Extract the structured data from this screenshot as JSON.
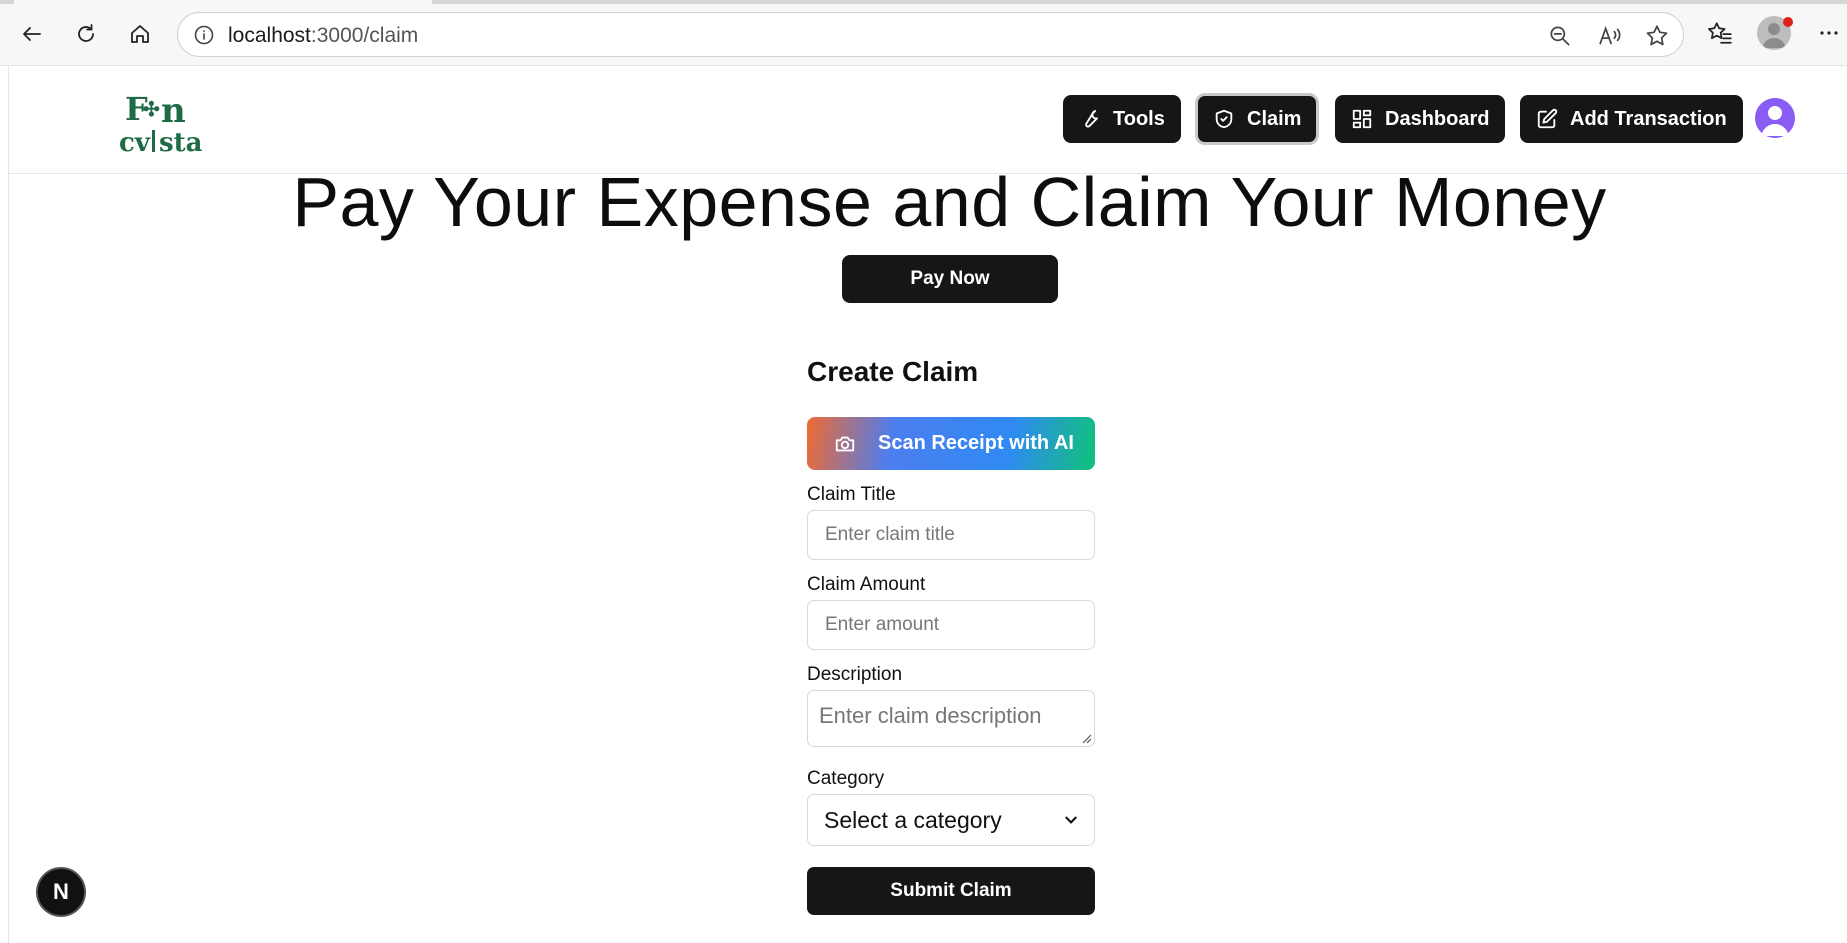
{
  "browser": {
    "url_host": "localhost",
    "url_path": ":3000/claim",
    "icons": [
      "back-arrow-icon",
      "refresh-icon",
      "home-icon",
      "info-icon",
      "zoom-out-icon",
      "read-aloud-icon",
      "favorite-star-icon",
      "favorites-icon",
      "profile-icon",
      "more-icon"
    ]
  },
  "header": {
    "logo_alt": "Fin cvista",
    "nav": [
      {
        "label": "Tools",
        "icon": "wrench-icon"
      },
      {
        "label": "Claim",
        "icon": "shield-icon",
        "active": true
      },
      {
        "label": "Dashboard",
        "icon": "dashboard-icon"
      },
      {
        "label": "Add Transaction",
        "icon": "edit-icon"
      }
    ]
  },
  "hero": {
    "title": "Pay Your Expense and Claim Your Money",
    "pay_button": "Pay Now"
  },
  "form": {
    "title": "Create Claim",
    "scan_button": "Scan Receipt with AI",
    "title_label": "Claim Title",
    "title_placeholder": "Enter claim title",
    "amount_label": "Claim Amount",
    "amount_placeholder": "Enter amount",
    "description_label": "Description",
    "description_placeholder": "Enter claim description",
    "category_label": "Category",
    "category_selected": "Select a category",
    "submit_button": "Submit Claim"
  },
  "dev_indicator": "N",
  "colors": {
    "button_dark": "#161616",
    "avatar": "#8a5cf6",
    "logo_green": "#1e6b45",
    "notification": "#e0201b"
  }
}
